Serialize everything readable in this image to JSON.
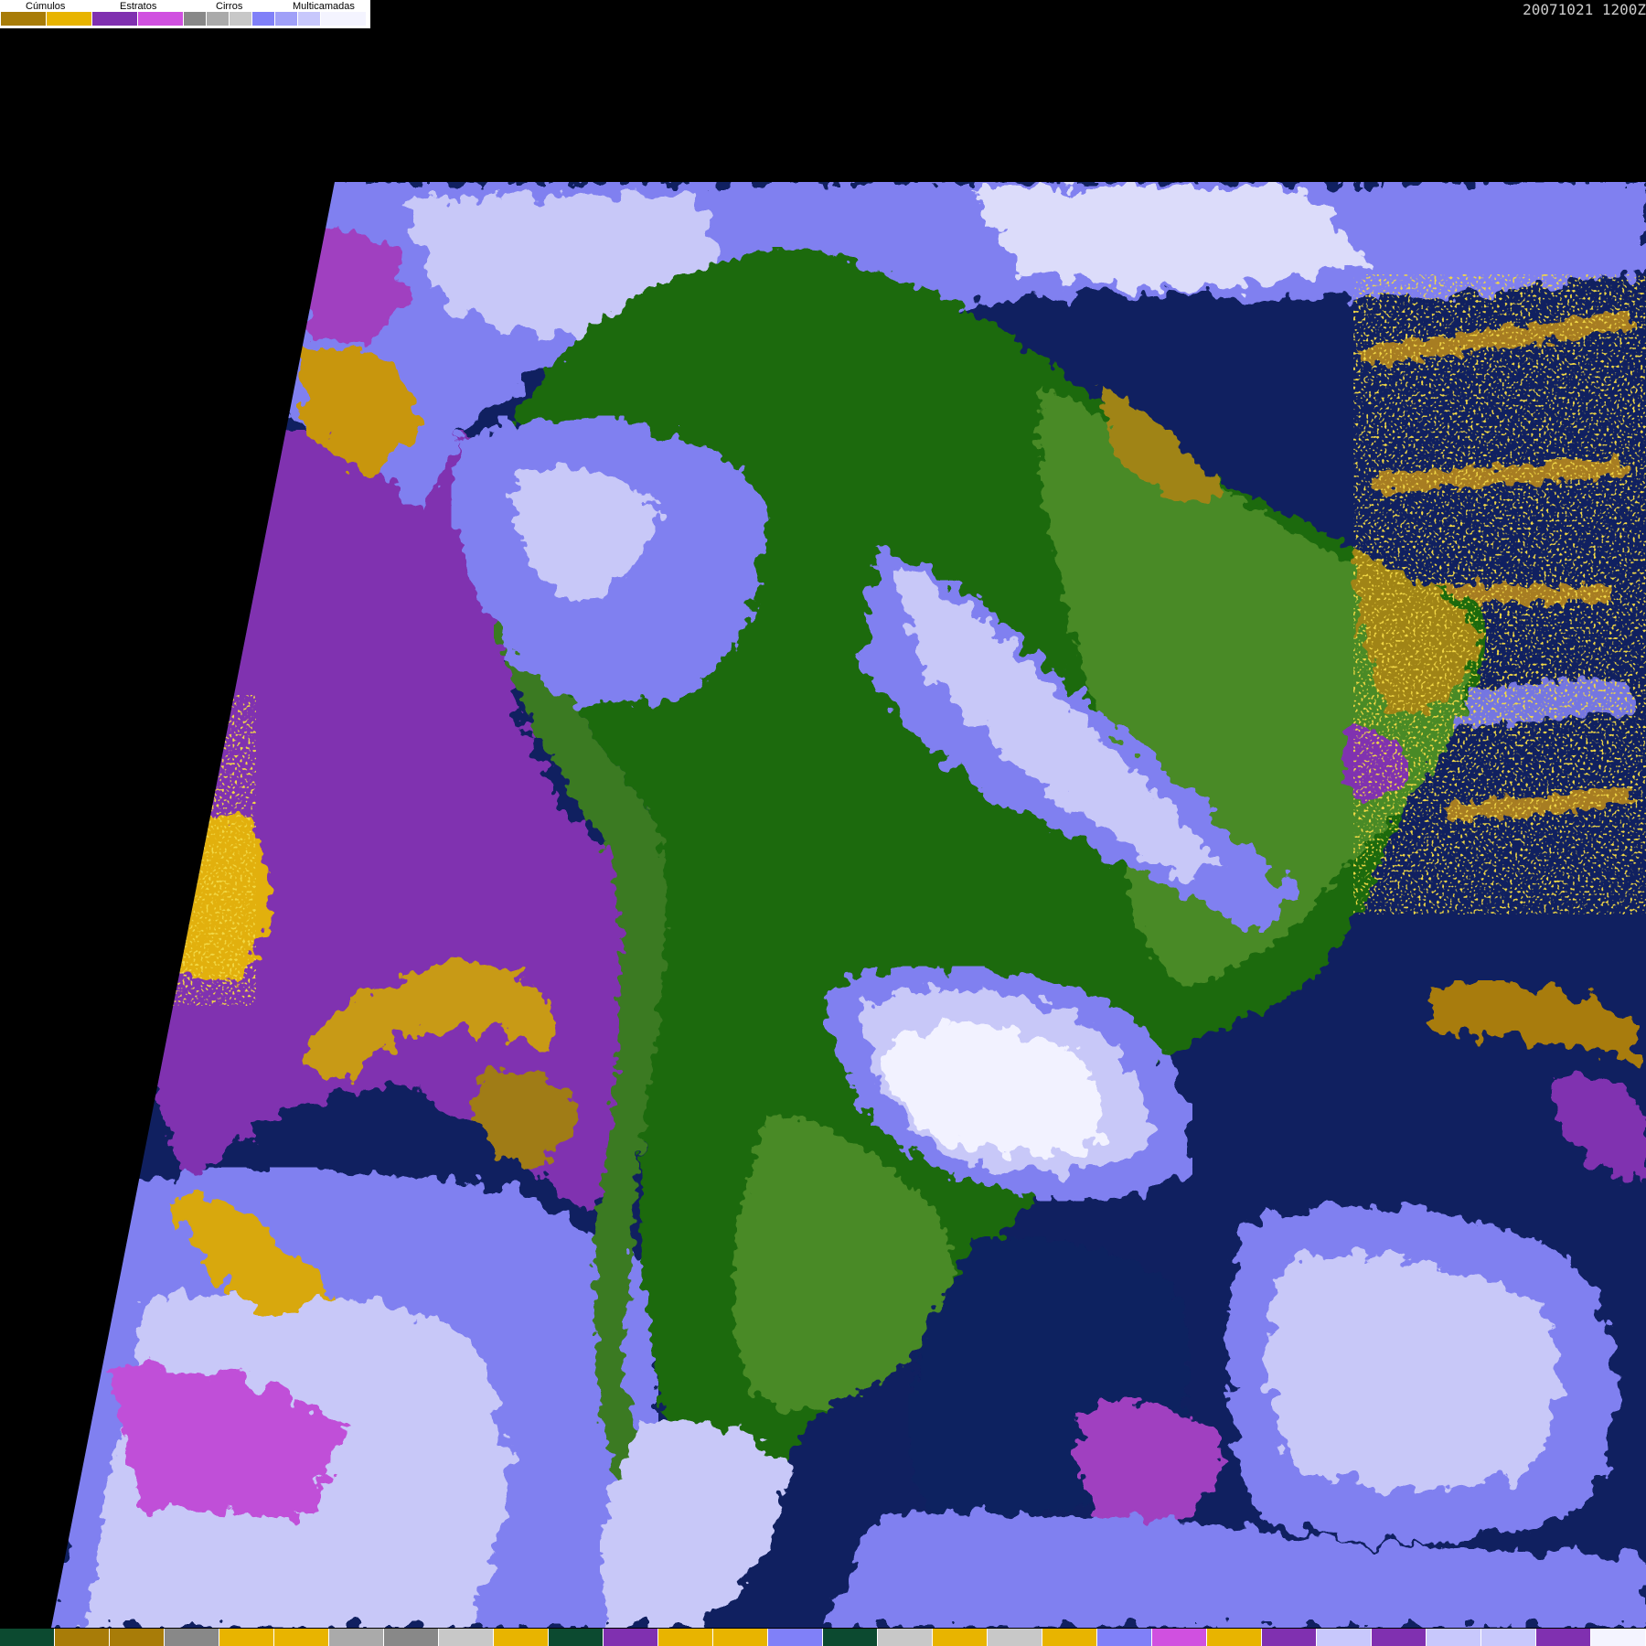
{
  "legend": {
    "labels": [
      "Cúmulos",
      "Estratos",
      "Cirros",
      "Multicamadas"
    ],
    "swatch_colors": [
      "#a87c08",
      "#e8b400",
      "#8030b0",
      "#d050e0",
      "#888888",
      "#aaaaaa",
      "#c8c8c8",
      "#8080f8",
      "#a0a0f8",
      "#c8c8fc",
      "#f4f4ff"
    ]
  },
  "timestamp": "20071021 1200Z",
  "colors": {
    "background": "#000000",
    "ocean": "#102060",
    "stratus_ocean": "#8030b0",
    "land_forest": "#1f6a10",
    "land_green": "#4a8a28",
    "land_dry": "#a08418",
    "cirrus_blue": "#8080f0",
    "light_cloud": "#c8c8f8",
    "white_cloud": "#f2f2ff",
    "cumulus_yellow": "#e2b010"
  },
  "bottom_strip": {
    "colors": [
      "#0c4a30",
      "#a87c08",
      "#a87c08",
      "#888888",
      "#e8b400",
      "#e8b400",
      "#aaaaaa",
      "#888888",
      "#c8c8c8",
      "#e8b400",
      "#0c4a30",
      "#8030b0",
      "#e8b400",
      "#e8b400",
      "#8080f8",
      "#0c4a30",
      "#c8c8c8",
      "#e8b400",
      "#c8c8c8",
      "#e8b400",
      "#8080f8",
      "#d050e0",
      "#e8b400",
      "#8030b0",
      "#c8c8fc",
      "#8030b0",
      "#c8c8fc",
      "#c8c8fc",
      "#8030b0",
      "#f4f4ff"
    ]
  }
}
